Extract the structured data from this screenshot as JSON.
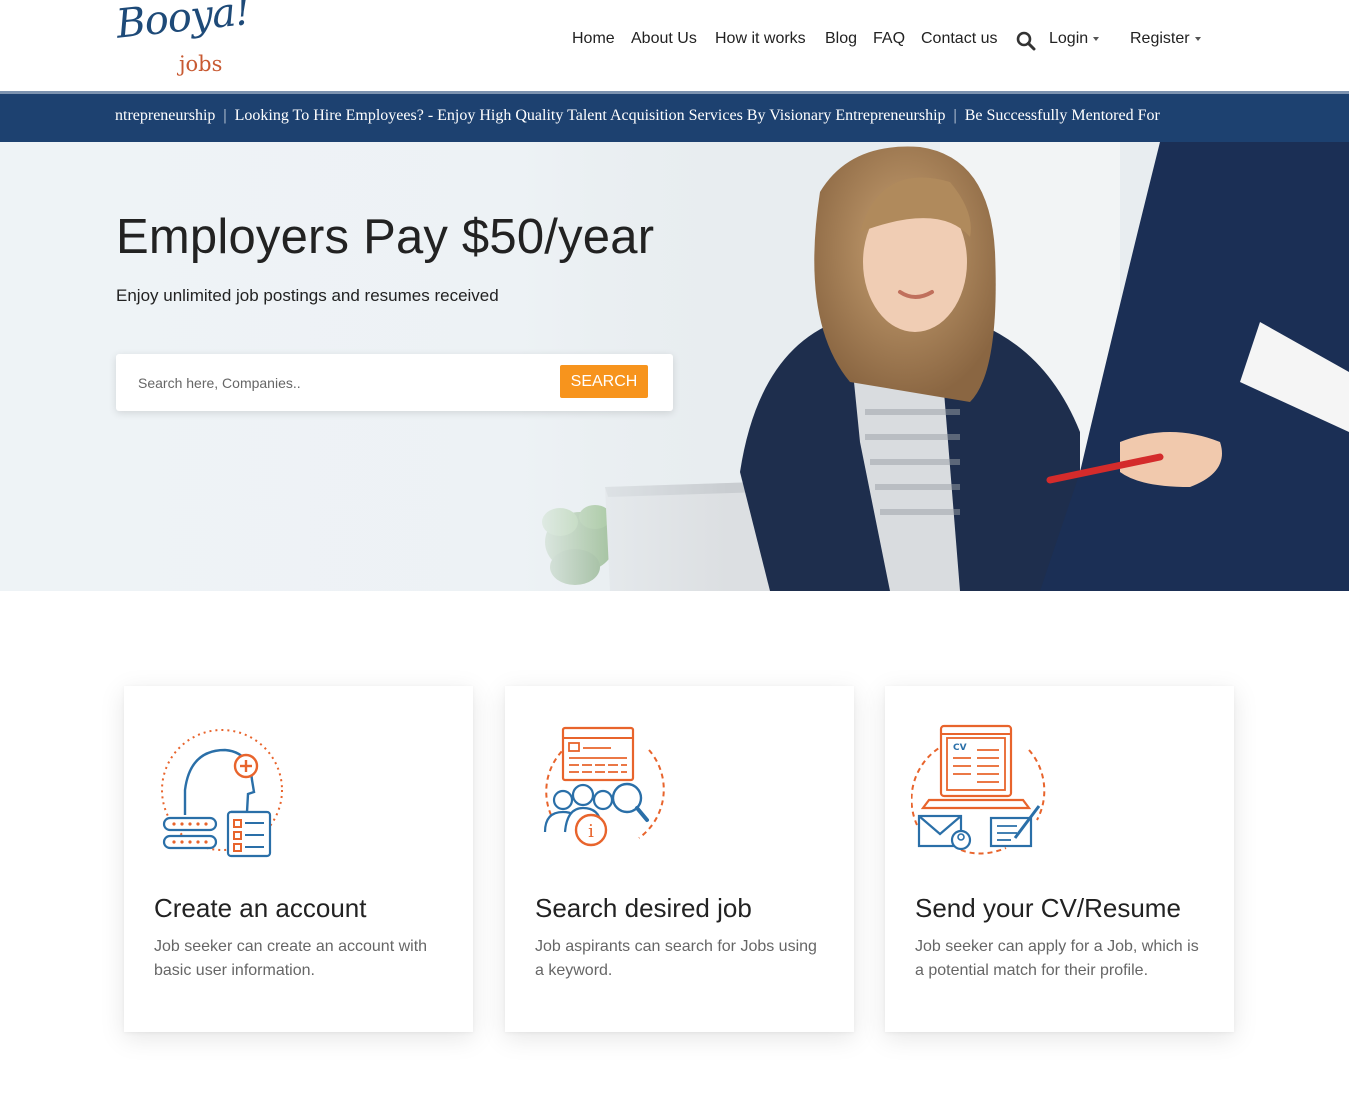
{
  "brand": {
    "logo_script": "Booya!",
    "logo_sub": "jobs"
  },
  "nav": {
    "items": [
      "Home",
      "About Us",
      "How it works",
      "Blog",
      "FAQ",
      "Contact us"
    ],
    "login_label": "Login",
    "register_label": "Register"
  },
  "ticker": {
    "segments": [
      "ntrepreneurship",
      "Looking To Hire Employees? - Enjoy High Quality Talent Acquisition Services By Visionary Entrepreneurship",
      "Be Successfully Mentored For"
    ],
    "separator": "|"
  },
  "hero": {
    "title": "Employers Pay $50/year",
    "subtitle": "Enjoy unlimited job postings and resumes received",
    "search_placeholder": "Search here, Companies..",
    "search_button": "SEARCH"
  },
  "cards": [
    {
      "title": "Create an account",
      "description": "Job seeker can create an account with basic user information."
    },
    {
      "title": "Search desired job",
      "description": "Job aspirants can search for Jobs using a keyword."
    },
    {
      "title": "Send your CV/Resume",
      "description": "Job seeker can apply for a Job, which is a potential match for their profile."
    }
  ],
  "colors": {
    "ticker_bg": "#1d4170",
    "accent_orange": "#f7941d",
    "icon_blue": "#2a6fa8",
    "icon_orange": "#e8642c"
  }
}
